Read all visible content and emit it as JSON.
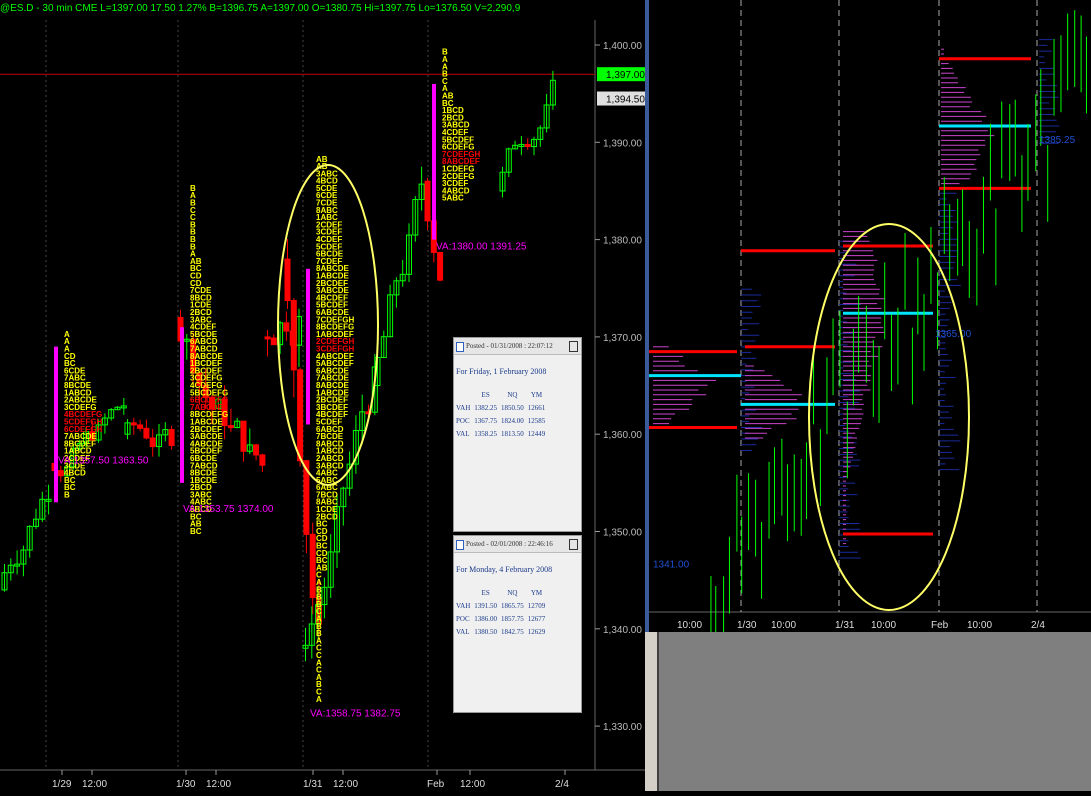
{
  "left_chart": {
    "header": "@ES.D - 30 min  CME  L=1397.00  17.50  1.27%  B=1396.75  A=1397.00  O=1380.75  Hi=1397.75  Lo=1376.50  V=2,290,9",
    "price_axis": [
      "1,400.00",
      "1,390.00",
      "1,380.00",
      "1,370.00",
      "1,360.00",
      "1,350.00",
      "1,340.00",
      "1,330.00"
    ],
    "last_price": "1,397.00",
    "prev_price": "1,394.50",
    "time_axis": [
      "1/29",
      "12:00",
      "1/30",
      "12:00",
      "1/31",
      "12:00",
      "Feb",
      "12:00",
      "2/4"
    ],
    "va_labels": [
      "VA:1357.50 1363.50",
      "VA:1353.75 1374.00",
      "VA:1358.75 1382.75",
      "VA:1380.00 1391.25"
    ],
    "colors": {
      "up": "#00ff00",
      "down": "#ff0000",
      "profile": "#ffff00",
      "poc": "#ff00ff",
      "va": "#ff00ff",
      "grid": "#444444"
    }
  },
  "notes": [
    {
      "posted": "Posted - 01/31/2008 : 22:07:12",
      "title": "For Friday, 1 February 2008",
      "cols": [
        "ES",
        "NQ",
        "YM"
      ],
      "rows": [
        {
          "label": "VAH",
          "es": "1382.25",
          "nq": "1850.50",
          "ym": "12661"
        },
        {
          "label": "POC",
          "es": "1367.75",
          "nq": "1824.00",
          "ym": "12585"
        },
        {
          "label": "VAL",
          "es": "1358.25",
          "nq": "1813.50",
          "ym": "12449"
        }
      ]
    },
    {
      "posted": "Posted - 02/01/2008 : 22:46:16",
      "title": "For Monday, 4 February 2008",
      "cols": [
        "ES",
        "NQ",
        "YM"
      ],
      "rows": [
        {
          "label": "VAH",
          "es": "1391.50",
          "nq": "1865.75",
          "ym": "12709"
        },
        {
          "label": "POC",
          "es": "1386.00",
          "nq": "1857.75",
          "ym": "12677"
        },
        {
          "label": "VAL",
          "es": "1380.50",
          "nq": "1842.75",
          "ym": "12629"
        }
      ]
    }
  ],
  "right_chart": {
    "time_axis": [
      "10:00",
      "1/30",
      "10:00",
      "1/31",
      "10:00",
      "Feb",
      "10:00",
      "2/4"
    ],
    "labels": [
      "1341.00",
      "1365.00",
      "1385.25"
    ],
    "colors": {
      "profile": "#cc44cc",
      "poc": "#00e5ff",
      "va": "#ff0000",
      "volume": "#1a2a9a",
      "price": "#00ff00"
    }
  },
  "chart_data": {
    "type": "bar",
    "title": "@ES.D - 30 min",
    "ylim": [
      1325,
      1403
    ],
    "x": [
      "1/29",
      "1/30",
      "1/31",
      "Feb",
      "2/4"
    ],
    "value_areas": [
      {
        "day": "1/29",
        "val": 1357.5,
        "vah": 1363.5
      },
      {
        "day": "1/30",
        "val": 1353.75,
        "vah": 1374.0
      },
      {
        "day": "1/31",
        "val": 1358.75,
        "vah": 1382.75
      },
      {
        "day": "Feb",
        "val": 1380.0,
        "vah": 1391.25
      }
    ],
    "last": 1397.0,
    "grid": true
  }
}
